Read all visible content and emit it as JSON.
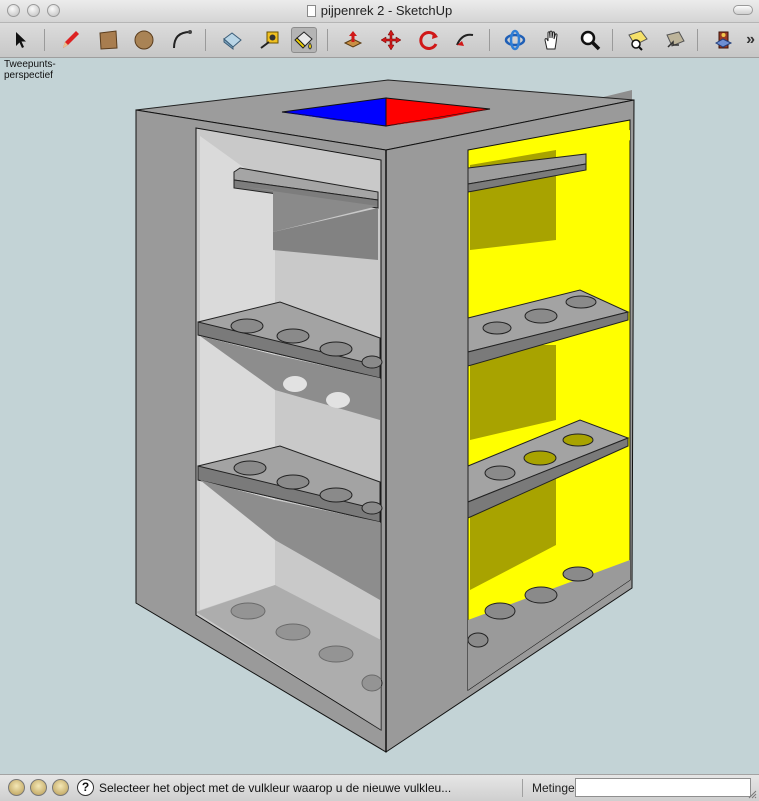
{
  "window": {
    "title": "pijpenrek 2 - SketchUp"
  },
  "toolbar": {
    "tools": [
      {
        "name": "select-tool",
        "icon": "arrow-pointer-icon"
      },
      {
        "name": "pencil-tool",
        "icon": "pencil-icon"
      },
      {
        "name": "rectangle-tool",
        "icon": "rectangle-icon"
      },
      {
        "name": "circle-tool",
        "icon": "circle-icon"
      },
      {
        "name": "arc-tool",
        "icon": "arc-icon"
      },
      {
        "name": "eraser-tool",
        "icon": "eraser-icon"
      },
      {
        "name": "tape-measure-tool",
        "icon": "tape-measure-icon"
      },
      {
        "name": "paint-bucket-tool",
        "icon": "paint-bucket-icon",
        "active": true
      },
      {
        "name": "push-pull-tool",
        "icon": "push-pull-icon"
      },
      {
        "name": "move-tool",
        "icon": "move-icon"
      },
      {
        "name": "rotate-tool",
        "icon": "rotate-icon"
      },
      {
        "name": "follow-me-tool",
        "icon": "follow-me-icon"
      },
      {
        "name": "orbit-tool",
        "icon": "orbit-icon"
      },
      {
        "name": "pan-tool",
        "icon": "hand-icon"
      },
      {
        "name": "zoom-tool",
        "icon": "magnifier-icon"
      },
      {
        "name": "zoom-extents-tool",
        "icon": "zoom-extents-icon"
      },
      {
        "name": "previous-view-tool",
        "icon": "previous-view-icon"
      },
      {
        "name": "get-models-tool",
        "icon": "warehouse-icon"
      }
    ],
    "overflow_label": "»"
  },
  "viewport": {
    "camera_label": "Tweepunts- perspectief",
    "colors": {
      "background": "#c3d3d6",
      "frame_gray": "#9a9a9a",
      "panel_light": "#d6d6d6",
      "panel_yellow": "#ffff00",
      "top_red": "#ff0000",
      "top_blue": "#0000ff"
    }
  },
  "status": {
    "hint": "Selecteer het object met de vulkleur waarop u de nieuwe vulkleu...",
    "measurements_label": "Metingen",
    "measurements_value": ""
  }
}
